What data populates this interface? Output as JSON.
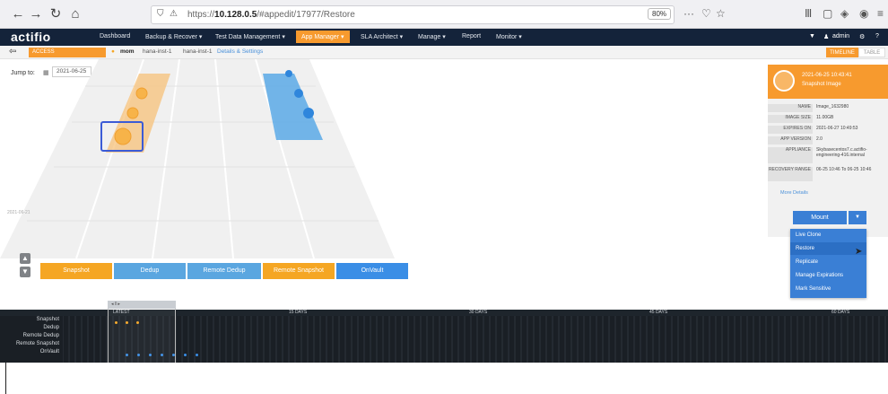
{
  "browser": {
    "url_prefix": "https://",
    "url_host": "10.128.0.5",
    "url_path": "/#appedit/17977/Restore",
    "zoom": "80%",
    "more": "···"
  },
  "app_nav": {
    "logo": "actifio",
    "items": [
      "Dashboard",
      "Backup & Recover ▾",
      "Test Data Management ▾",
      "App Manager ▾",
      "SLA Architect ▾",
      "Manage ▾",
      "Report",
      "Monitor ▾"
    ],
    "active_index": 3,
    "user": "admin"
  },
  "sub_bar": {
    "access": "ACCESS",
    "app_name": "mom",
    "host1": "hana-inst-1",
    "host2": "hana-inst-1",
    "details_link": "Details & Settings",
    "view_timeline": "TIMELINE",
    "view_table": "TABLE"
  },
  "timeline": {
    "jump_label": "Jump to:",
    "jump_date": "2021-06-25",
    "date_label": "2021-06-21",
    "categories": [
      "Snapshot",
      "Dedup",
      "Remote Dedup",
      "Remote Snapshot",
      "OnVault"
    ],
    "cat_colors": [
      "#f5a623",
      "#5aa6e0",
      "#5aa6e0",
      "#f5a623",
      "#3a8ee6"
    ]
  },
  "detail": {
    "time": "2021-06-25 10:43:41",
    "type": "Snapshot Image",
    "fields": [
      {
        "k": "NAME",
        "v": "Image_1632980"
      },
      {
        "k": "IMAGE SIZE",
        "v": "11.00GB"
      },
      {
        "k": "EXPIRES ON",
        "v": "2021-06-27 10:49:53"
      },
      {
        "k": "APP VERSION",
        "v": "2.0"
      },
      {
        "k": "APPLIANCE",
        "v": "Skybasecentos7.c.actifio-engineering-416.internal"
      },
      {
        "k": "RECOVERY RANGE",
        "v": "06-25 10:46 To 06-25 10:46"
      }
    ],
    "more_details": "More Details",
    "mount": "Mount",
    "menu": [
      "Live Clone",
      "Restore",
      "Replicate",
      "Manage Expirations",
      "Mark Sensitive"
    ]
  },
  "bottom": {
    "labels": [
      "Snapshot",
      "Dedup",
      "Remote Dedup",
      "Remote Snapshot",
      "OnVault"
    ],
    "marks": [
      "LATEST",
      "15 DAYS",
      "30 DAYS",
      "45 DAYS",
      "60 DAYS"
    ],
    "slider_label": "◂ ‖ ▸"
  }
}
